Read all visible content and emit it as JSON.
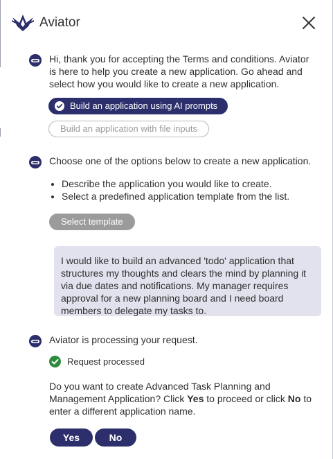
{
  "header": {
    "title": "Aviator",
    "logo_icon": "aviator-logo-icon",
    "close_icon": "close-icon"
  },
  "conversation": {
    "intro": {
      "text": "Hi, thank you for accepting the Terms and conditions. Aviator is here to help you create a new application. Go ahead and select how you would like to create a new application.",
      "options": [
        {
          "label": "Build an application using AI prompts",
          "selected": true
        },
        {
          "label": "Build an application with file inputs",
          "selected": false
        }
      ]
    },
    "choose": {
      "text": "Choose one of the options below to create a new application.",
      "bullets": [
        "Describe the application you would like to create.",
        "Select a predefined application template from the list."
      ],
      "template_button": "Select template"
    },
    "user_message": "I would like to build an advanced 'todo' application that structures my thoughts and clears the mind by planning it via due dates and notifications. My manager requires approval for a new planning board and I need board members to delegate my tasks to.",
    "processing": {
      "text": "Aviator is processing your request.",
      "status": "Request processed",
      "confirm_pre": "Do you want to create Advanced Task Planning and Management Application? Click ",
      "confirm_yes": "Yes",
      "confirm_mid": " to proceed or click ",
      "confirm_no": "No",
      "confirm_post": " to enter a different application name.",
      "yes_label": "Yes",
      "no_label": "No"
    }
  },
  "colors": {
    "brand": "#2c2f6b",
    "bubble": "#e1e2ed",
    "success": "#2e8b3e"
  }
}
